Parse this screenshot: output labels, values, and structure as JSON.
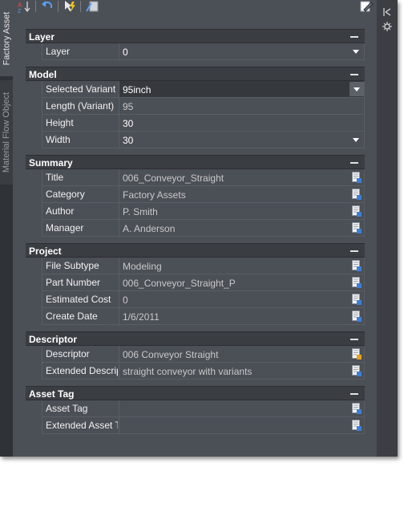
{
  "tabs": {
    "factory_asset": "Factory Asset",
    "material_flow_object": "Material Flow Object"
  },
  "toolbar": {
    "icons": [
      "sort-icon",
      "undo-icon",
      "quick-select-icon",
      "field-icon",
      "edit-icon"
    ]
  },
  "side_icons": [
    "auto-hide-icon",
    "properties-icon"
  ],
  "sections": {
    "layer": {
      "title": "Layer",
      "rows": [
        {
          "label": "Layer",
          "value": "0"
        }
      ]
    },
    "model": {
      "title": "Model",
      "rows": [
        {
          "label": "Selected Variant",
          "value": "95inch"
        },
        {
          "label": "Length (Variant)",
          "value": "95"
        },
        {
          "label": "Height",
          "value": "30"
        },
        {
          "label": "Width",
          "value": "30"
        }
      ]
    },
    "summary": {
      "title": "Summary",
      "rows": [
        {
          "label": "Title",
          "value": "006_Conveyor_Straight"
        },
        {
          "label": "Category",
          "value": "Factory Assets"
        },
        {
          "label": "Author",
          "value": "P. Smith"
        },
        {
          "label": "Manager",
          "value": "A. Anderson"
        }
      ]
    },
    "project": {
      "title": "Project",
      "rows": [
        {
          "label": "File Subtype",
          "value": "Modeling"
        },
        {
          "label": "Part Number",
          "value": "006_Conveyor_Straight_P"
        },
        {
          "label": "Estimated Cost",
          "value": "0"
        },
        {
          "label": "Create Date",
          "value": "1/6/2011"
        }
      ]
    },
    "descriptor": {
      "title": "Descriptor",
      "rows": [
        {
          "label": "Descriptor",
          "value": "006 Conveyor Straight"
        },
        {
          "label": "Extended Descrip",
          "value": "straight conveyor with variants"
        }
      ]
    },
    "asset_tag": {
      "title": "Asset Tag",
      "rows": [
        {
          "label": "Asset Tag",
          "value": ""
        },
        {
          "label": "Extended Asset T",
          "value": ""
        }
      ]
    }
  },
  "colors": {
    "panel": "#4b4f56",
    "header": "#3a3d42",
    "strip": "#2f3237",
    "text": "#f2f2f2"
  }
}
